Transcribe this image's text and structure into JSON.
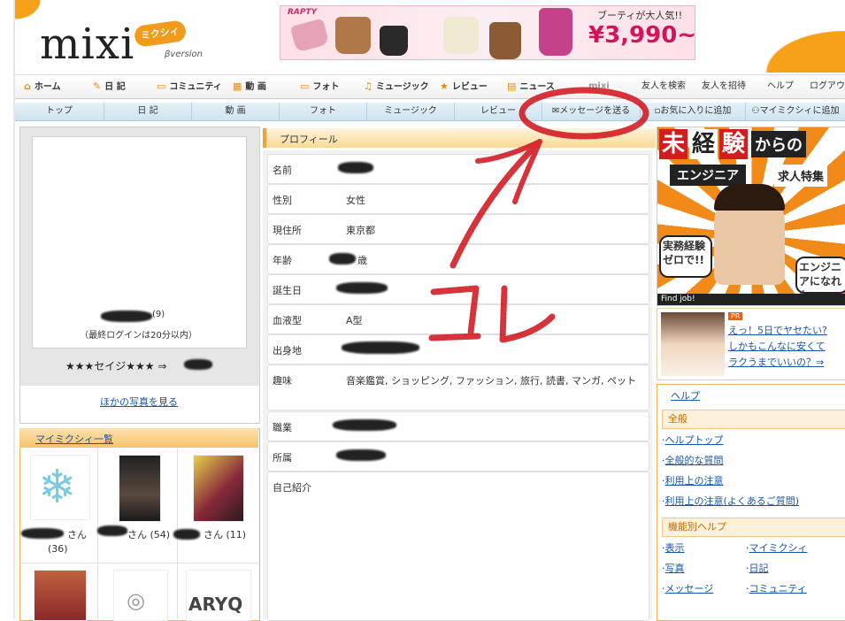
{
  "header": {
    "logo_text": "mixi",
    "logo_badge": "ミクシィ",
    "logo_beta": "βversion",
    "banner": {
      "brand": "RAPTY",
      "copy": "ブーティが大人気!!",
      "price": "¥3,990~"
    }
  },
  "nav": {
    "items": [
      {
        "label": "ホーム",
        "icon": "home-icon",
        "glyph": "⌂"
      },
      {
        "label": "日 記",
        "icon": "pencil-icon",
        "glyph": "✎"
      },
      {
        "label": "コミュニティ",
        "icon": "chat-icon",
        "glyph": "▭"
      },
      {
        "label": "動 画",
        "icon": "film-icon",
        "glyph": "▦"
      },
      {
        "label": "フォト",
        "icon": "folder-icon",
        "glyph": "▭"
      },
      {
        "label": "ミュージック",
        "icon": "music-icon",
        "glyph": "♫"
      },
      {
        "label": "レビュー",
        "icon": "star-icon",
        "glyph": "★"
      },
      {
        "label": "ニュース",
        "icon": "news-icon",
        "glyph": "▤"
      },
      {
        "label": "mixi",
        "icon": "mixi-icon",
        "glyph": ""
      }
    ],
    "right_items": [
      "友人を検索",
      "友人を招待",
      "ヘルプ",
      "ログアウ"
    ]
  },
  "subnav": {
    "items": [
      "トップ",
      "日 記",
      "動 画",
      "フォト",
      "ミュージック",
      "レビュー",
      "メッセージを送る",
      "お気に入りに追加",
      "マイミクシィに追加"
    ]
  },
  "profile_left": {
    "name_suffix": "(9)",
    "last_login": "（最終ログインは20分以内）",
    "nickname_prefix": "★★★セイジ★★★ ⇒",
    "more_photos": "ほかの写真を見る"
  },
  "friends": {
    "title": "マイミクシィ一覧",
    "items": [
      {
        "suffix": "さん",
        "count": "(36)"
      },
      {
        "suffix": "さん (54)",
        "count": ""
      },
      {
        "suffix": "さん (11)",
        "count": ""
      }
    ],
    "row2_logo": "ARYQ"
  },
  "profile": {
    "title": "プロフィール",
    "rows": [
      {
        "label": "名前",
        "value": ""
      },
      {
        "label": "性別",
        "value": "女性"
      },
      {
        "label": "現住所",
        "value": "東京都"
      },
      {
        "label": "年齢",
        "value": "歳"
      },
      {
        "label": "誕生日",
        "value": ""
      },
      {
        "label": "血液型",
        "value": "A型"
      },
      {
        "label": "出身地",
        "value": ""
      },
      {
        "label": "趣味",
        "value": "音楽鑑賞, ショッピング, ファッション, 旅行, 読書, マンガ, ペット"
      },
      {
        "label": "職業",
        "value": ""
      },
      {
        "label": "所属",
        "value": ""
      },
      {
        "label": "自己紹介",
        "value": ""
      }
    ]
  },
  "ads": {
    "ad1_title_a": "未",
    "ad1_title_b": "経",
    "ad1_title_c": "験",
    "ad1_title_d": "からの",
    "ad1_sub": "エンジニア",
    "ad1_sub2": "求人特集",
    "ad1_bubble": "実務経験ゼロで!!",
    "ad1_right": "エンジニアになれた",
    "ad1_footer": "Find job!",
    "ad2_pr": "PR",
    "ad2_lines": [
      "えっ！5日でヤセたい?",
      "しかもこんなに安くて",
      "ラクうまでいいの？⇒"
    ]
  },
  "help": {
    "title": "ヘルプ",
    "general_header": "全般",
    "general_links": [
      "ヘルプトップ",
      "全般的な質問",
      "利用上の注意",
      "利用上の注意(よくあるご質問)"
    ],
    "feature_header": "機能別ヘルプ",
    "feature_links_left": [
      "表示",
      "写真",
      "メッセージ"
    ],
    "feature_links_right": [
      "マイミクシィ",
      "日記",
      "コミュニティ"
    ]
  },
  "annotation": {
    "text": "コレ",
    "color": "#d0101a"
  }
}
